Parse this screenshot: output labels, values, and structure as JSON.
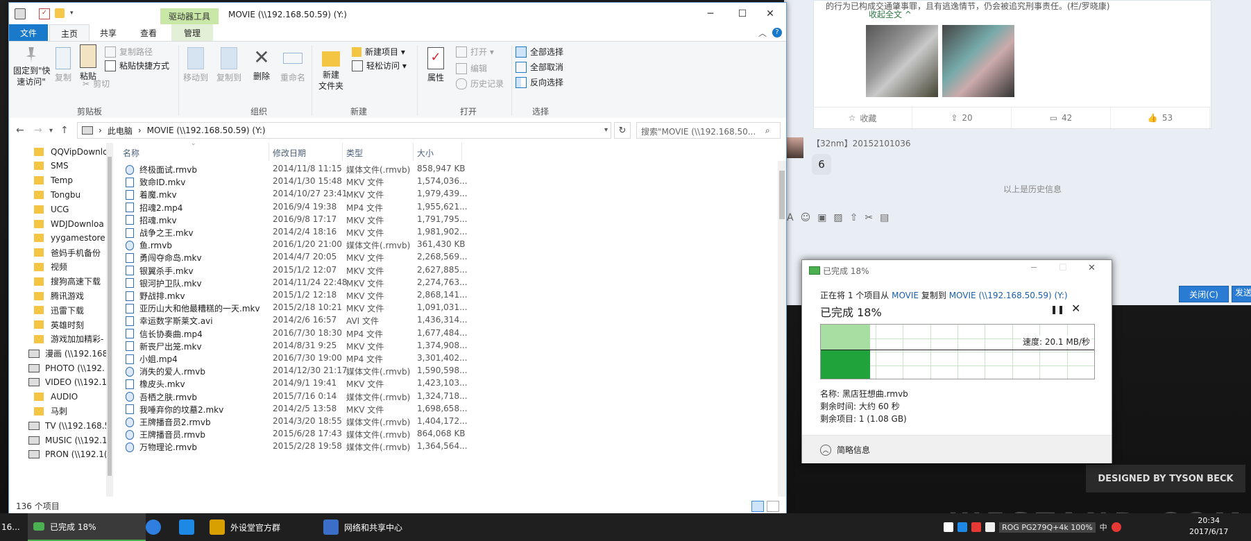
{
  "desktop": {
    "watermark": "DESIGNED BY TYSON BECK",
    "brand": "WESTAND.COM"
  },
  "chat": {
    "post_text": "的行为已构成交通肇事罪，且有逃逸情节，仍会被追究刑事责任。(栏/罗晓康)",
    "collapse": "收起全文 ^",
    "actions": [
      {
        "icon": "star-icon",
        "label": "收藏"
      },
      {
        "icon": "share-icon",
        "label": "20"
      },
      {
        "icon": "comment-icon",
        "label": "42"
      },
      {
        "icon": "thumbs-up-icon",
        "label": "53"
      }
    ],
    "sender": "【32nm】20152101036",
    "message": "6",
    "history_divider": "以上是历史信息",
    "close_button": "关闭(C)",
    "send_button": "发送"
  },
  "explorer": {
    "quick_toolbar_drop": "▾",
    "contextual_tab": "驱动器工具",
    "title": "MOVIE (\\\\192.168.50.59) (Y:)",
    "tabs": [
      "文件",
      "主页",
      "共享",
      "查看",
      "管理"
    ],
    "ribbon": {
      "pin": "固定到\"快\n速访问\"",
      "copy": "复制",
      "paste": "粘贴",
      "copy_path": "复制路径",
      "paste_shortcut": "粘贴快捷方式",
      "cut": "剪切",
      "clipboard_group": "剪贴板",
      "move_to": "移动到",
      "copy_to": "复制到",
      "delete": "删除",
      "rename": "重命名",
      "organize_group": "组织",
      "new_folder": "新建\n文件夹",
      "new_item": "新建项目 ▾",
      "easy_access": "轻松访问 ▾",
      "new_group": "新建",
      "properties": "属性",
      "open": "打开 ▾",
      "edit": "编辑",
      "history": "历史记录",
      "open_group": "打开",
      "select_all": "全部选择",
      "select_none": "全部取消",
      "invert_selection": "反向选择",
      "select_group": "选择"
    },
    "address": {
      "root": "此电脑",
      "current": "MOVIE (\\\\192.168.50.59) (Y:)",
      "search_placeholder": "搜索\"MOVIE (\\\\192.168.50..."
    },
    "nav_items": [
      {
        "type": "folder",
        "label": "QQVipDownlo"
      },
      {
        "type": "folder",
        "label": "SMS"
      },
      {
        "type": "folder",
        "label": "Temp"
      },
      {
        "type": "folder",
        "label": "Tongbu"
      },
      {
        "type": "folder",
        "label": "UCG"
      },
      {
        "type": "folder",
        "label": "WDJDownloa"
      },
      {
        "type": "folder",
        "label": "yygamestore"
      },
      {
        "type": "folder",
        "label": "爸妈手机备份"
      },
      {
        "type": "folder",
        "label": "视频"
      },
      {
        "type": "folder",
        "label": "搜狗高速下载"
      },
      {
        "type": "folder",
        "label": "腾讯游戏"
      },
      {
        "type": "folder",
        "label": "迅雷下载"
      },
      {
        "type": "folder",
        "label": "英雄时刻"
      },
      {
        "type": "folder",
        "label": "游戏加加精彩-"
      },
      {
        "type": "drive",
        "label": "漫画 (\\\\192.168"
      },
      {
        "type": "drive",
        "label": "PHOTO (\\\\192."
      },
      {
        "type": "drive",
        "label": "VIDEO (\\\\192.1"
      },
      {
        "type": "subfolder",
        "label": "AUDIO"
      },
      {
        "type": "subfolder",
        "label": "马刺"
      },
      {
        "type": "drive",
        "label": "TV (\\\\192.168.5"
      },
      {
        "type": "drive",
        "label": "MUSIC (\\\\192.1"
      },
      {
        "type": "drive",
        "label": "PRON (\\\\192.1("
      }
    ],
    "columns": [
      "名称",
      "修改日期",
      "类型",
      "大小"
    ],
    "files": [
      {
        "name": "终极面试.rmvb",
        "date": "2014/11/8 11:15",
        "type": "媒体文件(.rmvb)",
        "size": "858,947 KB",
        "media": true
      },
      {
        "name": "致命ID.mkv",
        "date": "2014/1/30 15:48",
        "type": "MKV 文件",
        "size": "1,574,036...",
        "media": false
      },
      {
        "name": "着魔.mkv",
        "date": "2014/10/27 23:41",
        "type": "MKV 文件",
        "size": "1,979,439...",
        "media": false
      },
      {
        "name": "招魂2.mp4",
        "date": "2016/9/4 19:38",
        "type": "MP4 文件",
        "size": "1,955,621...",
        "media": false
      },
      {
        "name": "招魂.mkv",
        "date": "2016/9/8 17:17",
        "type": "MKV 文件",
        "size": "1,791,795...",
        "media": false
      },
      {
        "name": "战争之王.mkv",
        "date": "2014/2/4 18:16",
        "type": "MKV 文件",
        "size": "1,981,902...",
        "media": false
      },
      {
        "name": "鱼.rmvb",
        "date": "2016/1/20 21:00",
        "type": "媒体文件(.rmvb)",
        "size": "361,430 KB",
        "media": true
      },
      {
        "name": "勇闯夺命岛.mkv",
        "date": "2014/4/7 20:05",
        "type": "MKV 文件",
        "size": "2,268,569...",
        "media": false
      },
      {
        "name": "银翼杀手.mkv",
        "date": "2015/1/2 12:07",
        "type": "MKV 文件",
        "size": "2,627,885...",
        "media": false
      },
      {
        "name": "银河护卫队.mkv",
        "date": "2014/11/24 22:48",
        "type": "MKV 文件",
        "size": "2,274,763...",
        "media": false
      },
      {
        "name": "野战排.mkv",
        "date": "2015/1/2 12:18",
        "type": "MKV 文件",
        "size": "2,868,141...",
        "media": false
      },
      {
        "name": "亚历山大和他最糟糕的一天.mkv",
        "date": "2015/2/18 10:21",
        "type": "MKV 文件",
        "size": "1,091,031...",
        "media": false
      },
      {
        "name": "幸运数字斯莱文.avi",
        "date": "2014/2/6 16:57",
        "type": "AVI 文件",
        "size": "1,436,314...",
        "media": false
      },
      {
        "name": "信长协奏曲.mp4",
        "date": "2016/7/30 18:30",
        "type": "MP4 文件",
        "size": "1,677,484...",
        "media": false
      },
      {
        "name": "新丧尸出笼.mkv",
        "date": "2014/8/31 9:25",
        "type": "MKV 文件",
        "size": "1,374,908...",
        "media": false
      },
      {
        "name": "小姐.mp4",
        "date": "2016/7/30 19:00",
        "type": "MP4 文件",
        "size": "3,301,402...",
        "media": false
      },
      {
        "name": "消失的爱人.rmvb",
        "date": "2014/12/30 21:17",
        "type": "媒体文件(.rmvb)",
        "size": "1,590,598...",
        "media": true
      },
      {
        "name": "橡皮头.mkv",
        "date": "2014/9/1 19:41",
        "type": "MKV 文件",
        "size": "1,423,103...",
        "media": false
      },
      {
        "name": "吾栖之肤.rmvb",
        "date": "2015/7/16 0:14",
        "type": "媒体文件(.rmvb)",
        "size": "1,324,718...",
        "media": true
      },
      {
        "name": "我唾弃你的坟墓2.mkv",
        "date": "2014/2/5 13:58",
        "type": "MKV 文件",
        "size": "1,698,658...",
        "media": false
      },
      {
        "name": "王牌播音员2.rmvb",
        "date": "2014/3/20 18:55",
        "type": "媒体文件(.rmvb)",
        "size": "1,404,172...",
        "media": true
      },
      {
        "name": "王牌播音员.rmvb",
        "date": "2015/6/28 17:43",
        "type": "媒体文件(.rmvb)",
        "size": "864,068 KB",
        "media": true
      },
      {
        "name": "万物理论.rmvb",
        "date": "2015/2/28 19:58",
        "type": "媒体文件(.rmvb)",
        "size": "1,364,564...",
        "media": true
      }
    ],
    "status": "136 个项目"
  },
  "copy_dialog": {
    "title": "已完成 18%",
    "desc_prefix": "正在将 1 个项目从",
    "desc_from": "MOVIE",
    "desc_mid": "复制到",
    "desc_to": "MOVIE (\\\\192.168.50.59) (Y:)",
    "percent_text": "已完成 18%",
    "progress": 0.18,
    "speed": "速度: 20.1 MB/秒",
    "name_line": "名称: 黑店狂想曲.rmvb",
    "time_line": "剩余时间: 大约 60 秒",
    "items_line": "剩余项目: 1 (1.08 GB)",
    "more_info": "简略信息"
  },
  "taskbar": {
    "left_text": "16...",
    "active_app": "已完成 18%",
    "apps": [
      {
        "icon": "browser-icon",
        "label": ""
      },
      {
        "icon": "feather-icon",
        "label": ""
      },
      {
        "icon": "qq-group-icon",
        "label": "外设堂官方群"
      },
      {
        "icon": "network-icon",
        "label": "网络和共享中心"
      }
    ],
    "tray_ime": "中",
    "tray_overlay": "ROG PG279Q+4k 100%",
    "clock_time": "20:34",
    "clock_date": "2017/6/17"
  },
  "colors": {
    "accent": "#1979ca",
    "progress_light": "#a7dea2",
    "progress_dark": "#1fa33a",
    "taskbar": "#1f1f1f"
  }
}
